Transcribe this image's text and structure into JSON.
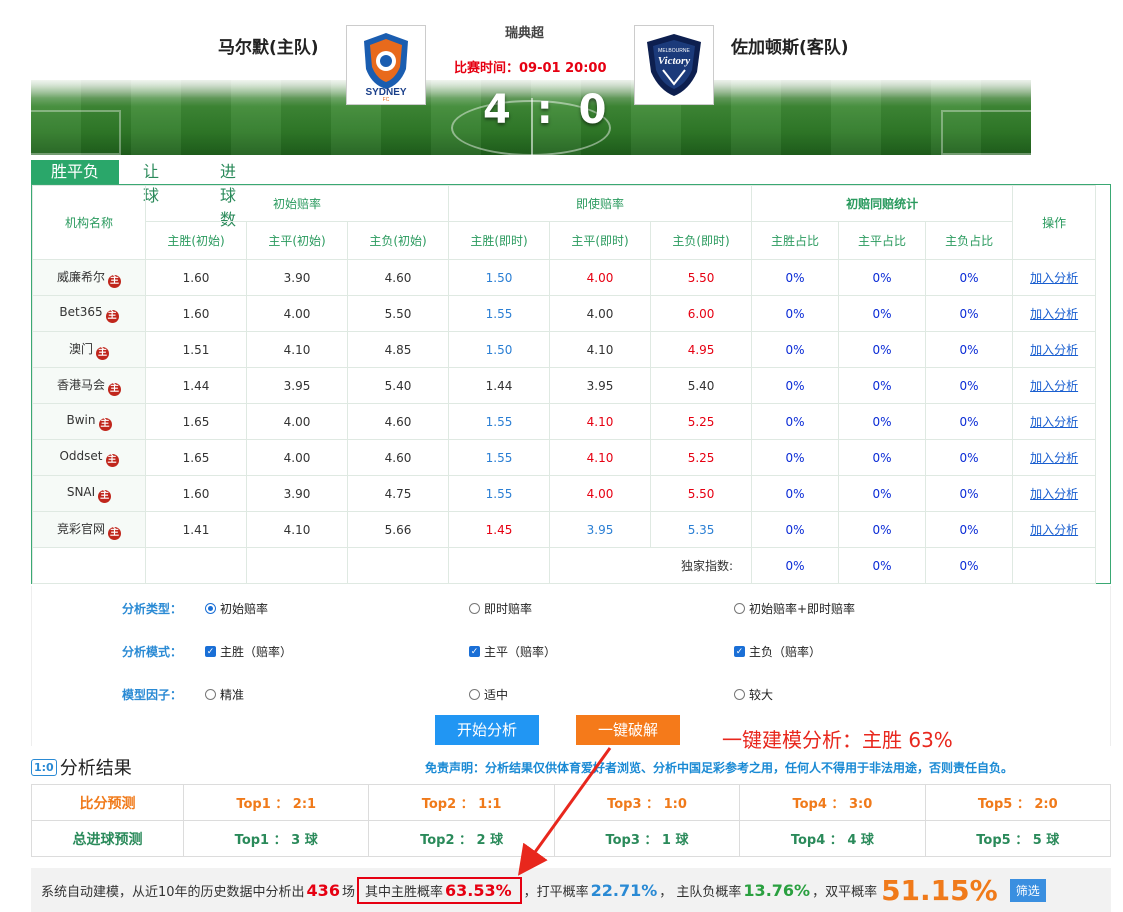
{
  "header": {
    "home_team": "马尔默(主队)",
    "away_team": "佐加顿斯(客队)",
    "league": "瑞典超",
    "match_time": "比赛时间：09-01 20:00",
    "score": "4 : 0",
    "home_logo_text": "SYDNEY",
    "home_logo_sub": "FC",
    "away_logo_text": "Victory",
    "away_logo_sub": "MELBOURNE"
  },
  "tabs": [
    {
      "label": "胜平负",
      "active": true
    },
    {
      "label": "让球",
      "active": false
    },
    {
      "label": "进球数",
      "active": false
    }
  ],
  "odds_table": {
    "col_org": "机构名称",
    "group_initial": "初始赔率",
    "group_live": "即使赔率",
    "group_stats": "初赔同赔统计",
    "col_action": "操作",
    "sub_headers": [
      "主胜(初始)",
      "主平(初始)",
      "主负(初始)",
      "主胜(即时)",
      "主平(即时)",
      "主负(即时)",
      "主胜占比",
      "主平占比",
      "主负占比"
    ],
    "badge": "主",
    "rows": [
      {
        "name": "威廉希尔",
        "i": [
          "1.60",
          "3.90",
          "4.60"
        ],
        "l": [
          "1.50",
          "4.00",
          "5.50"
        ],
        "lc": [
          "blue",
          "red",
          "red"
        ],
        "p": [
          "0%",
          "0%",
          "0%"
        ],
        "action": "加入分析"
      },
      {
        "name": "Bet365",
        "i": [
          "1.60",
          "4.00",
          "5.50"
        ],
        "l": [
          "1.55",
          "4.00",
          "6.00"
        ],
        "lc": [
          "blue",
          "black",
          "red"
        ],
        "p": [
          "0%",
          "0%",
          "0%"
        ],
        "action": "加入分析"
      },
      {
        "name": "澳门",
        "i": [
          "1.51",
          "4.10",
          "4.85"
        ],
        "l": [
          "1.50",
          "4.10",
          "4.95"
        ],
        "lc": [
          "blue",
          "black",
          "red"
        ],
        "p": [
          "0%",
          "0%",
          "0%"
        ],
        "action": "加入分析"
      },
      {
        "name": "香港马会",
        "i": [
          "1.44",
          "3.95",
          "5.40"
        ],
        "l": [
          "1.44",
          "3.95",
          "5.40"
        ],
        "lc": [
          "black",
          "black",
          "black"
        ],
        "p": [
          "0%",
          "0%",
          "0%"
        ],
        "action": "加入分析"
      },
      {
        "name": "Bwin",
        "i": [
          "1.65",
          "4.00",
          "4.60"
        ],
        "l": [
          "1.55",
          "4.10",
          "5.25"
        ],
        "lc": [
          "blue",
          "red",
          "red"
        ],
        "p": [
          "0%",
          "0%",
          "0%"
        ],
        "action": "加入分析"
      },
      {
        "name": "Oddset",
        "i": [
          "1.65",
          "4.00",
          "4.60"
        ],
        "l": [
          "1.55",
          "4.10",
          "5.25"
        ],
        "lc": [
          "blue",
          "red",
          "red"
        ],
        "p": [
          "0%",
          "0%",
          "0%"
        ],
        "action": "加入分析"
      },
      {
        "name": "SNAI",
        "i": [
          "1.60",
          "3.90",
          "4.75"
        ],
        "l": [
          "1.55",
          "4.00",
          "5.50"
        ],
        "lc": [
          "blue",
          "red",
          "red"
        ],
        "p": [
          "0%",
          "0%",
          "0%"
        ],
        "action": "加入分析"
      },
      {
        "name": "竞彩官网",
        "i": [
          "1.41",
          "4.10",
          "5.66"
        ],
        "l": [
          "1.45",
          "3.95",
          "5.35"
        ],
        "lc": [
          "red",
          "blue",
          "blue"
        ],
        "p": [
          "0%",
          "0%",
          "0%"
        ],
        "action": "加入分析"
      }
    ],
    "exclusive_label": "独家指数:",
    "exclusive_values": [
      "0%",
      "0%",
      "0%"
    ]
  },
  "options": {
    "type_label": "分析类型：",
    "type_options": [
      "初始赔率",
      "即时赔率",
      "初始赔率+即时赔率"
    ],
    "mode_label": "分析模式：",
    "mode_options": [
      "主胜（赔率）",
      "主平（赔率）",
      "主负（赔率）"
    ],
    "factor_label": "模型因子：",
    "factor_options": [
      "精准",
      "适中",
      "较大"
    ],
    "start_button": "开始分析",
    "crack_button": "一键破解"
  },
  "annotation": "一键建模分析：主胜 63%",
  "results": {
    "icon": "1:0",
    "title": "分析结果",
    "disclaimer": "免责声明：分析结果仅供体育爱好者浏览、分析中国足彩参考之用，任何人不得用于非法用途，否则责任自负。",
    "score_label": "比分预测",
    "score_preds": [
      "Top1 ： 2:1",
      "Top2 ： 1:1",
      "Top3 ： 1:0",
      "Top4 ： 3:0",
      "Top5 ： 2:0"
    ],
    "goals_label": "总进球预测",
    "goals_preds": [
      "Top1 ： 3 球",
      "Top2 ： 2 球",
      "Top3 ： 1 球",
      "Top4 ： 4 球",
      "Top5 ： 5 球"
    ]
  },
  "summary": {
    "prefix": "系统自动建模，从近10年的历史数据中分析出",
    "count": "436",
    "count_unit": "场",
    "home_label": "其中主胜概率",
    "home_pct": "63.53%",
    "draw_label": "，打平概率",
    "draw_pct": "22.71%",
    "loss_label": "， 主队负概率",
    "loss_pct": "13.76%",
    "double_label": "，双平概率",
    "double_pct": "51.15%",
    "filter_button": "筛选"
  },
  "colors": {
    "accent_green": "#2aa76a",
    "button_blue": "#2196f3",
    "button_orange": "#f57a1a",
    "highlight_red": "#e60012"
  }
}
